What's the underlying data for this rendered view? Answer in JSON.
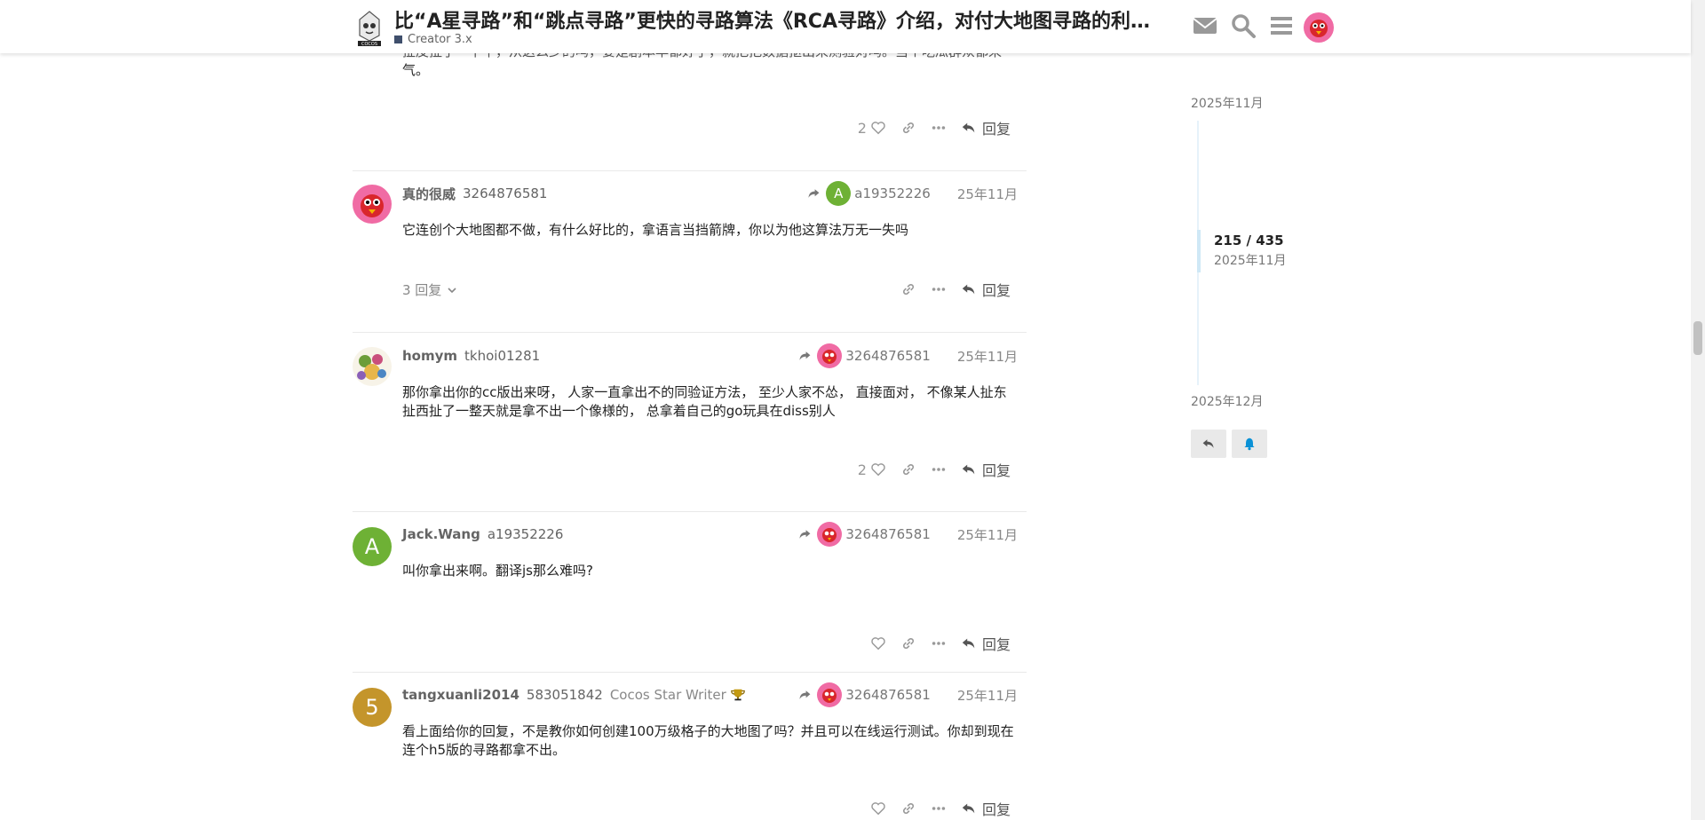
{
  "header": {
    "title": "比“A星寻路”和“跳点寻路”更快的寻路算法《RCA寻路》介绍，对付大地图寻路的利器。",
    "category": "Creator 3.x",
    "icons": [
      "mail-icon",
      "search-icon",
      "hamburger-menu-icon",
      "user-avatar"
    ]
  },
  "posts": [
    {
      "body_tail_1": "扯皮扯了一下午，从这么少的吗，要是剧本早都好了，就把把数据抠出来测验对吗。当个吃瓜群众都来",
      "body_tail_2": "气。",
      "likes": "2",
      "reply_label": "回复"
    },
    {
      "username": "真的很威",
      "handle": "3264876581",
      "reply_to_letter": "A",
      "reply_to": "a19352226",
      "date": "25年11月",
      "body": "它连创个大地图都不做，有什么好比的，拿语言当挡箭牌，你以为他这算法万无一失吗",
      "replies_count": "3 回复",
      "reply_label": "回复"
    },
    {
      "username": "homym",
      "handle": "tkhoi01281",
      "reply_to": "3264876581",
      "date": "25年11月",
      "body_line_1": "那你拿出你的cc版出来呀， 人家一直拿出不的同验证方法， 至少人家不怂， 直接面对， 不像某人扯东",
      "body_line_2": "扯西扯了一整天就是拿不出一个像様的， 总拿着自己的go玩具在diss别人",
      "likes": "2",
      "reply_label": "回复"
    },
    {
      "username": "Jack.Wang",
      "handle": "a19352226",
      "avatar_letter": "A",
      "reply_to": "3264876581",
      "date": "25年11月",
      "body": "叫你拿出来啊。翻译js那么难吗?",
      "reply_label": "回复"
    },
    {
      "username": "tangxuanli2014",
      "handle": "583051842",
      "user_title": "Cocos Star Writer",
      "avatar_letter": "5",
      "reply_to": "3264876581",
      "date": "25年11月",
      "body_line_1": "看上面给你的回复，不是教你如何创建100万级格子的大地图了吗？并且可以在线运行测试。你却到现在",
      "body_line_2": "连个h5版的寻路都拿不出。",
      "reply_label": "回复"
    }
  ],
  "timeline": {
    "top_date": "2025年11月",
    "position": "215 / 435",
    "position_date": "2025年11月",
    "bottom_date": "2025年12月",
    "progress": 0.494
  },
  "colors": {
    "green_avatar": "#6eb135",
    "gold_avatar": "#c4952b",
    "category": "#3f4f6c",
    "notify_blue": "#0a91d6"
  }
}
